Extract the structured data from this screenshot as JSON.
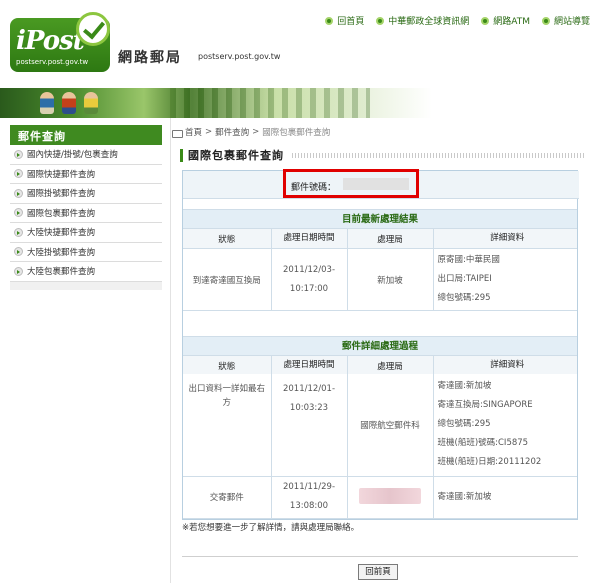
{
  "header": {
    "logo_text": "iPost",
    "logo_subtext": "postserv.post.gov.tw",
    "site_name": "網路郵局",
    "site_url": "postserv.post.gov.tw",
    "nav": [
      {
        "label": "回首頁",
        "icon": "green-bullet-icon"
      },
      {
        "label": "中華郵政全球資訊網",
        "icon": "green-bullet-icon"
      },
      {
        "label": "網路ATM",
        "icon": "green-bullet-icon"
      },
      {
        "label": "網站導覽",
        "icon": "green-bullet-icon"
      }
    ]
  },
  "sidebar": {
    "title": "郵件查詢",
    "items": [
      {
        "label": "國內快捷/掛號/包裹查詢"
      },
      {
        "label": "國際快捷郵件查詢"
      },
      {
        "label": "國際掛號郵件查詢"
      },
      {
        "label": "國際包裹郵件查詢"
      },
      {
        "label": "大陸快捷郵件查詢"
      },
      {
        "label": "大陸掛號郵件查詢"
      },
      {
        "label": "大陸包裹郵件查詢"
      }
    ]
  },
  "breadcrumb": {
    "home": "首頁",
    "sep1": ">",
    "section": "郵件查詢",
    "sep2": ">",
    "current": "國際包裹郵件查詢"
  },
  "page_title": "國際包裹郵件查詢",
  "tracking": {
    "label": "郵件號碼：",
    "value_redacted": true
  },
  "latest": {
    "heading": "目前最新處理結果",
    "columns": [
      "狀態",
      "處理日期時間",
      "處理局",
      "詳細資料"
    ],
    "row": {
      "status": "到達寄達國互換局",
      "date": "2011/12/03-",
      "time": "10:17:00",
      "office": "新加坡",
      "details": [
        "原寄國:中華民國",
        "出口局:TAIPEI",
        "總包號碼:295"
      ]
    }
  },
  "history": {
    "heading": "郵件詳細處理過程",
    "columns": [
      "狀態",
      "處理日期時間",
      "處理局",
      "詳細資料"
    ],
    "rows": [
      {
        "status_line1": "出口資料一詳如最右",
        "status_line2": "方",
        "date": "2011/12/01-",
        "time": "10:03:23",
        "office": "國際航空郵件科",
        "details": [
          "寄達國:新加坡",
          "寄達互換局:SINGAPORE",
          "總包號碼:295",
          "班機(船班)號碼:CI5875",
          "班機(船班)日期:20111202"
        ]
      },
      {
        "status": "交寄郵件",
        "date": "2011/11/29-",
        "time": "13:08:00",
        "office_redacted": true,
        "details": [
          "寄達國:新加坡"
        ]
      }
    ]
  },
  "note": "※若您想要進一步了解詳情，請與處理局聯絡。",
  "back_button": "回前頁",
  "colors": {
    "brand_green": "#3a8a18",
    "highlight_red": "#e00000",
    "office_red": "#d00000"
  }
}
